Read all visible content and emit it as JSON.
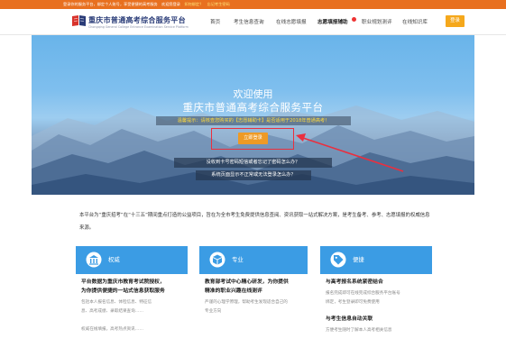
{
  "topbar": {
    "part1": "登录你的服务平台，绑定个人账号，享受便捷的高考服务",
    "part2": "欢迎您登录",
    "link1": "如何绑定？",
    "link2": "忘记考生密码"
  },
  "header": {
    "logo_title": "重庆市普通高考综合服务平台",
    "logo_sub": "Chongqing General College Entrance Examination Service Platform",
    "nav": [
      "首页",
      "考生信息查询",
      "在线志愿填报",
      "志愿填报辅助",
      "职业规划测评",
      "在线知识库"
    ],
    "login": "登录"
  },
  "hero": {
    "title1": "欢迎使用",
    "title2": "重庆市普通高考综合服务平台",
    "notice": "温馨提示：请核查您购买的【志愿辅助卡】是否适用于2018年普通高考！",
    "start_button": "立即登录",
    "question1": "没收到卡号密码短信或者忘记了密码怎么办？",
    "question2": "系统页面显示不正常或无法登录怎么办？"
  },
  "intro": {
    "text": "本平台为“重庆招考”在“十三五”期间重点打造的公益项目，旨在为全市考生免费提供信息查阅、资讯获取一站式解决方案，是考生备考、参考、志愿填报的权威信息来源。"
  },
  "cards": [
    {
      "title": "权威",
      "heading1": "平台数据为重庆市教育考试院授权，",
      "heading2": "为你提供便捷的一站式信息获取服务",
      "text1": "包括本人报名信息、体检信息、特征信",
      "text2": "息、高考成绩、录取结果查询……",
      "text3": "权威在线填报，高考热点资讯……"
    },
    {
      "title": "专业",
      "heading1": "教育部考试中心精心研发，为你提供",
      "heading2": "精准的职业兴趣在线测评",
      "text1": "严谨的心理学原理，帮助考生发现适合自己的",
      "text2": "专业方向"
    },
    {
      "title": "便捷",
      "heading1": "与高考报名系统紧密结合",
      "text1": "报名完成即可在线完成综合服务平台账号",
      "text2": "绑定，考生登录即可免费使用",
      "heading2": "与考生信息自动关联",
      "text3": "方便考生随时了解本人高考相关信息"
    }
  ],
  "colors": {
    "topbar": "#e8701f",
    "brand_blue": "#2a3c78",
    "card_blue": "#3b9ce4",
    "login_orange": "#f5a81c",
    "highlight_red": "#ea2f3e"
  }
}
